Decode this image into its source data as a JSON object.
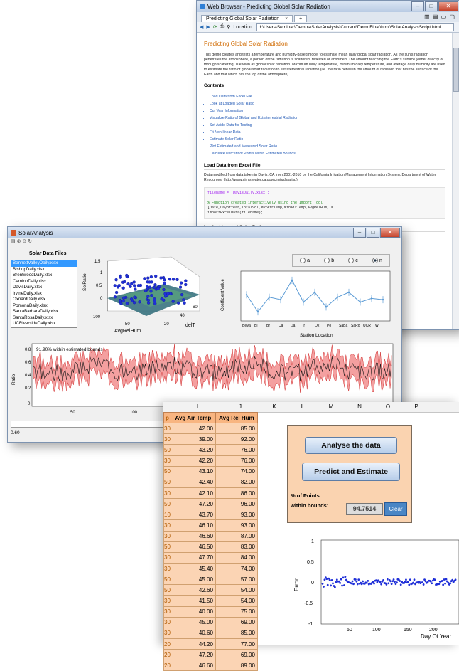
{
  "browser": {
    "title": "Web Browser - Predicting Global Solar Radiation",
    "tab_label": "Predicting Global Solar Radiation",
    "tab_close": "×",
    "tab_add": "+",
    "location_label": "Location:",
    "location_url": "d:\\Users\\Seminar\\Demos\\SolarAnalysis\\Current\\DemoFinal\\html\\SolarAnalysisScript.html",
    "page_title": "Predicting Global Solar Radiation",
    "intro": "This demo creates and tests a temperature and humidity-based model to estimate mean daily global solar radiation. As the sun's radiation penetrates the atmosphere, a portion of the radiation is scattered, reflected or absorbed. The amount reaching the Earth's surface (either directly or through scattering) is known as global solar radiation. Maximum daily temperature, minimum daily temperature, and average daily humidity are used to estimate the ratio of global solar radiation to extraterrestrial radiation (i.e. the ratio between the amount of radiation that hits the surface of the Earth and that which hits the top of the atmosphere).",
    "contents_heading": "Contents",
    "contents": [
      "Load Data from Excel File",
      "Look at Loaded Solar Ratio",
      "Cut Year Information",
      "Visualize Ratio of Global and Extraterrestrial Radiation",
      "Set Aside Data for Testing",
      "Fit Non-linear Data",
      "Estimate Solar Ratio",
      "Plot Estimated and Measured Solar Ratio",
      "Calculate Percent of Points within Estimated Bounds"
    ],
    "section1_heading": "Load Data from Excel File",
    "section1_text": "Data modified from data taken in Davis, CA from 2001-2010 by the California Irrigation Management Information System, Department of Water Resources. (http://www.cimis.water.ca.gov/cimis/data.jsp)",
    "code_line1": "filename = 'DavisDaily.xlsx';",
    "code_line2": "% Function created interactively using the Import Tool",
    "code_line3": "[Date,DayofYear,TotalSol,MaxAirTemp,MinAirTemp,AvgRelHum] = ...",
    "code_line4": "    importExcelData(filename);",
    "section2_heading": "Look at Loaded Solar Ratio"
  },
  "matlab": {
    "title": "SolarAnalysis",
    "files_heading": "Solar Data Files",
    "files": [
      "BennettValleyDaily.xlsx",
      "BishopDaily.xlsx",
      "BrentwoodDaily.xlsx",
      "CaminoDaily.xlsx",
      "DavisDaily.xlsx",
      "IrvineDaily.xlsx",
      "OxnardDaily.xlsx",
      "PomonaDaily.xlsx",
      "SantaBarbaraDaily.xlsx",
      "SantaRosaDaily.xlsx",
      "UCRiversideDaily.xlsx"
    ],
    "radio_options": [
      "a",
      "b",
      "c",
      "n"
    ],
    "radio_selected": "n",
    "surface_plot": {
      "zlabel": "SolRatio",
      "xlabel": "AvgRelHum",
      "ylabel": "delT",
      "zticks": [
        "0",
        "0.5",
        "1",
        "1.5"
      ],
      "xticks": [
        "100",
        "50"
      ],
      "yticks": [
        "20",
        "40",
        "60"
      ]
    },
    "coef_plot": {
      "ylabel": "Coefficient Value",
      "xlabel": "Station Location",
      "categories": [
        "BeVa",
        "Bi",
        "Br",
        "Ca",
        "Da",
        "Ir",
        "Ox",
        "Po",
        "SaBa",
        "SaRo",
        "UCR",
        "Wi"
      ],
      "values": [
        1.9,
        1.2,
        1.8,
        1.7,
        2.5,
        1.6,
        2.0,
        1.4,
        1.8,
        2.0,
        1.6,
        1.75,
        1.7
      ]
    },
    "ratio_plot": {
      "ylabel": "Ratio",
      "within_label": "91.90% within estimated bounds",
      "yticks": [
        "0",
        "0.2",
        "0.4",
        "0.6",
        "0.8"
      ],
      "xticks": [
        "50",
        "100"
      ]
    },
    "slider_value": "0.60"
  },
  "excel": {
    "column_letters": [
      "I",
      "J",
      "K",
      "L",
      "M",
      "N",
      "O",
      "P"
    ],
    "header_cut": "p",
    "header_temp": "Avg Air Temp",
    "header_hum": "Avg Rel Hum",
    "rows": [
      [
        "30",
        "42.00",
        "85.00"
      ],
      [
        "30",
        "39.00",
        "92.00"
      ],
      [
        "50",
        "43.20",
        "76.00"
      ],
      [
        "30",
        "42.20",
        "76.00"
      ],
      [
        "50",
        "43.10",
        "74.00"
      ],
      [
        "50",
        "42.40",
        "82.00"
      ],
      [
        "30",
        "42.10",
        "86.00"
      ],
      [
        "50",
        "47.20",
        "96.00"
      ],
      [
        "10",
        "43.70",
        "93.00"
      ],
      [
        "30",
        "46.10",
        "93.00"
      ],
      [
        "30",
        "46.60",
        "87.00"
      ],
      [
        "50",
        "46.50",
        "83.00"
      ],
      [
        "30",
        "47.70",
        "84.00"
      ],
      [
        "30",
        "45.40",
        "74.00"
      ],
      [
        "50",
        "45.00",
        "57.00"
      ],
      [
        "50",
        "42.60",
        "54.00"
      ],
      [
        "30",
        "41.50",
        "54.00"
      ],
      [
        "30",
        "40.00",
        "75.00"
      ],
      [
        "30",
        "45.00",
        "69.00"
      ],
      [
        "30",
        "40.60",
        "85.00"
      ],
      [
        "20",
        "44.20",
        "77.00"
      ],
      [
        "20",
        "47.20",
        "69.00"
      ],
      [
        "20",
        "46.60",
        "89.00"
      ]
    ],
    "btn_analyse": "Analyse the data",
    "btn_predict": "Predict and Estimate",
    "pct_label_1": "% of Points",
    "pct_label_2": "within bounds:",
    "pct_value": "94.7514",
    "btn_clear": "Clear",
    "error_plot": {
      "ylabel": "Error",
      "xlabel": "Day Of Year",
      "yticks": [
        "1",
        "0.5",
        "0",
        "-0.5",
        "-1"
      ],
      "xticks": [
        "50",
        "100",
        "150",
        "200"
      ]
    }
  }
}
